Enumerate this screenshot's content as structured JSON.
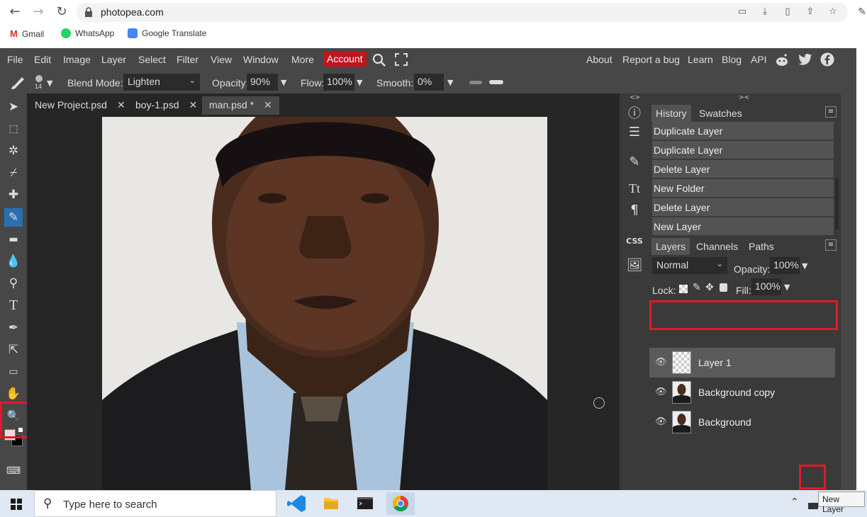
{
  "browser": {
    "url": "photopea.com",
    "bookmarks": [
      {
        "label": "Gmail"
      },
      {
        "label": "WhatsApp"
      },
      {
        "label": "Google Translate"
      }
    ]
  },
  "menubar": {
    "items": [
      "File",
      "Edit",
      "Image",
      "Layer",
      "Select",
      "Filter",
      "View",
      "Window",
      "More"
    ],
    "account": "Account",
    "right_items": [
      "About",
      "Report a bug",
      "Learn",
      "Blog",
      "API"
    ]
  },
  "options": {
    "brush_size": "14",
    "blend_mode_label": "Blend Mode:",
    "blend_mode": "Lighten",
    "opacity_label": "Opacity:",
    "opacity": "90%",
    "flow_label": "Flow:",
    "flow": "100%",
    "smooth_label": "Smooth:",
    "smooth": "0%"
  },
  "doc_tabs": [
    {
      "label": "New Project.psd"
    },
    {
      "label": "boy-1.psd"
    },
    {
      "label": "man.psd *"
    }
  ],
  "history": {
    "tabs": [
      "History",
      "Swatches"
    ],
    "items": [
      "Duplicate Layer",
      "Duplicate Layer",
      "Delete Layer",
      "New Folder",
      "Delete Layer",
      "New Layer"
    ]
  },
  "layers": {
    "tabs": [
      "Layers",
      "Channels",
      "Paths"
    ],
    "blend_mode": "Normal",
    "opacity_label": "Opacity:",
    "opacity": "100%",
    "lock_label": "Lock:",
    "fill_label": "Fill:",
    "fill": "100%",
    "items": [
      {
        "name": "Layer 1"
      },
      {
        "name": "Background copy"
      },
      {
        "name": "Background"
      }
    ]
  },
  "taskbar": {
    "search_placeholder": "Type here to search"
  },
  "tooltip": "New Layer",
  "icon_col": {
    "css_label": "CSS"
  },
  "colors": {
    "accent_red": "#e3182a",
    "account_red": "#c0151c",
    "panel_bg": "#3a3a3a",
    "app_bg": "#474747"
  }
}
